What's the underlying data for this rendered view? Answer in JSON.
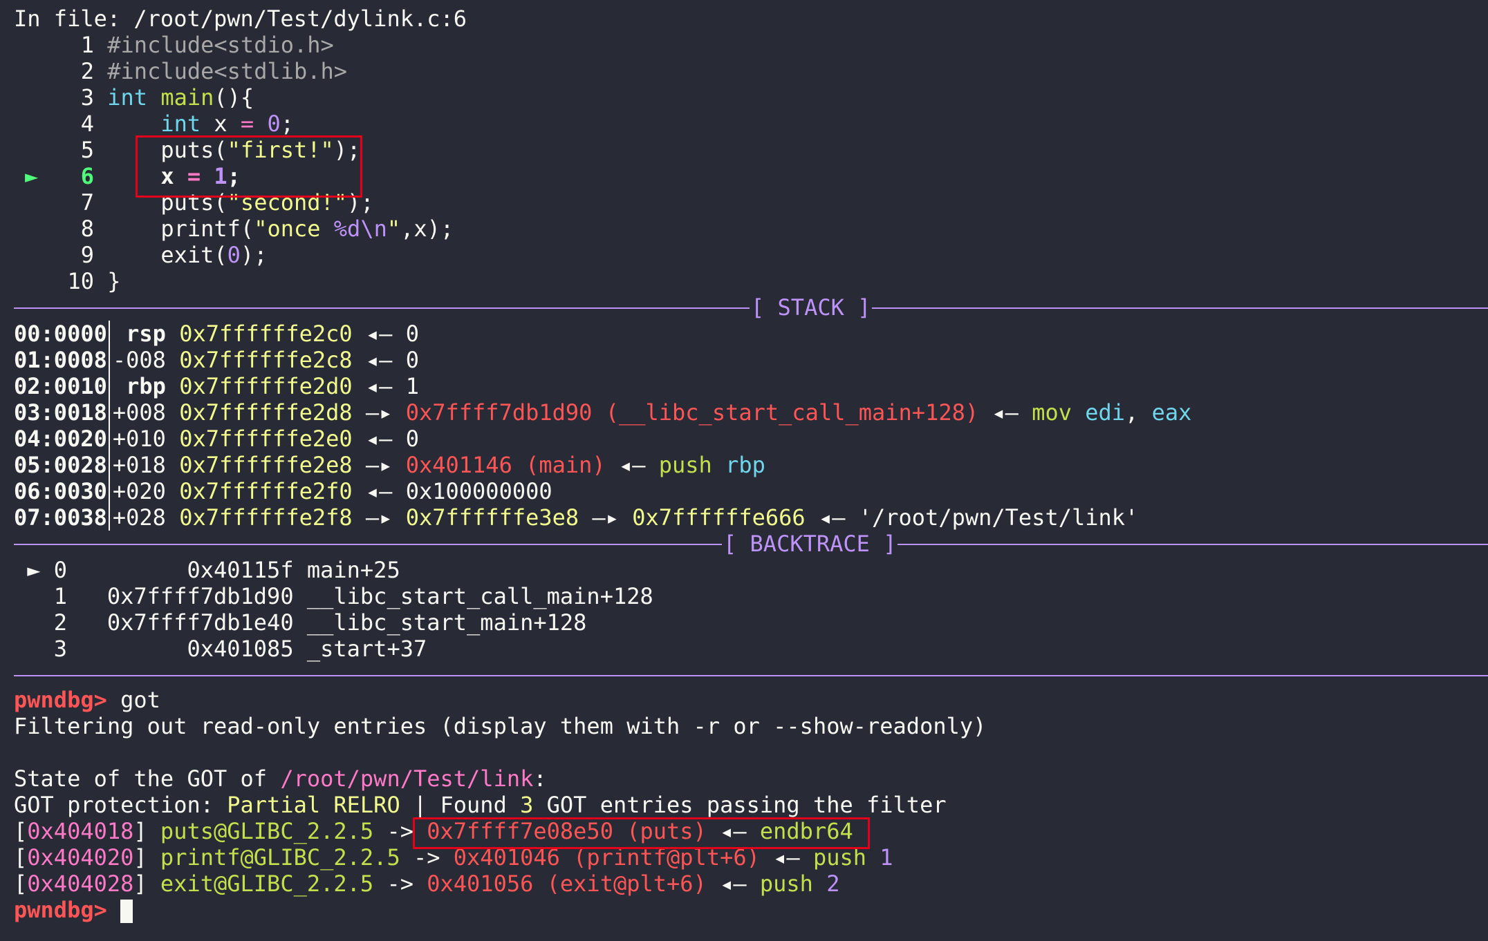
{
  "file_header": {
    "prefix": "In file: ",
    "path": "/root/pwn/Test/dylink.c:6"
  },
  "source": {
    "current_marker": "►",
    "lines": [
      {
        "no": "1",
        "tokens": [
          {
            "t": "#include<stdio.h>",
            "c": "gray"
          }
        ]
      },
      {
        "no": "2",
        "tokens": [
          {
            "t": "#include<stdlib.h>",
            "c": "gray"
          }
        ]
      },
      {
        "no": "3",
        "tokens": [
          {
            "t": "int",
            "c": "cyan"
          },
          {
            "t": " ",
            "c": "white"
          },
          {
            "t": "main",
            "c": "green"
          },
          {
            "t": "(){",
            "c": "white"
          }
        ]
      },
      {
        "no": "4",
        "tokens": [
          {
            "t": "    ",
            "c": "white"
          },
          {
            "t": "int",
            "c": "cyan"
          },
          {
            "t": " x ",
            "c": "white"
          },
          {
            "t": "=",
            "c": "pink"
          },
          {
            "t": " ",
            "c": "white"
          },
          {
            "t": "0",
            "c": "purple"
          },
          {
            "t": ";",
            "c": "white"
          }
        ]
      },
      {
        "no": "5",
        "tokens": [
          {
            "t": "    puts(",
            "c": "white"
          },
          {
            "t": "\"first!\"",
            "c": "strgreen"
          },
          {
            "t": ");",
            "c": "white"
          }
        ]
      },
      {
        "no": "6",
        "current": true,
        "tokens": [
          {
            "t": "    x ",
            "c": "white"
          },
          {
            "t": "=",
            "c": "pink"
          },
          {
            "t": " ",
            "c": "white"
          },
          {
            "t": "1",
            "c": "purple"
          },
          {
            "t": ";",
            "c": "white"
          }
        ]
      },
      {
        "no": "7",
        "tokens": [
          {
            "t": "    puts(",
            "c": "white"
          },
          {
            "t": "\"second!\"",
            "c": "strgreen"
          },
          {
            "t": ");",
            "c": "white"
          }
        ]
      },
      {
        "no": "8",
        "tokens": [
          {
            "t": "    printf(",
            "c": "white"
          },
          {
            "t": "\"once ",
            "c": "strgreen"
          },
          {
            "t": "%d",
            "c": "purple"
          },
          {
            "t": "\\n",
            "c": "purple"
          },
          {
            "t": "\"",
            "c": "strgreen"
          },
          {
            "t": ",x);",
            "c": "white"
          }
        ]
      },
      {
        "no": "9",
        "tokens": [
          {
            "t": "    exit(",
            "c": "white"
          },
          {
            "t": "0",
            "c": "purple"
          },
          {
            "t": ");",
            "c": "white"
          }
        ]
      },
      {
        "no": "10",
        "tokens": [
          {
            "t": "}",
            "c": "white"
          }
        ]
      }
    ]
  },
  "stack_section": {
    "label": "[ STACK ]",
    "rows": [
      {
        "idx": "00:0000",
        "off": " rsp",
        "off_bold": true,
        "addr": "0x7ffffffe2c0",
        "rest": [
          {
            "t": " ◂— ",
            "c": "white"
          },
          {
            "t": "0",
            "c": "white"
          }
        ]
      },
      {
        "idx": "01:0008",
        "off": "-008",
        "off_bold": false,
        "addr": "0x7ffffffe2c8",
        "rest": [
          {
            "t": " ◂— ",
            "c": "white"
          },
          {
            "t": "0",
            "c": "white"
          }
        ]
      },
      {
        "idx": "02:0010",
        "off": " rbp",
        "off_bold": true,
        "addr": "0x7ffffffe2d0",
        "rest": [
          {
            "t": " ◂— ",
            "c": "white"
          },
          {
            "t": "1",
            "c": "white"
          }
        ]
      },
      {
        "idx": "03:0018",
        "off": "+008",
        "off_bold": false,
        "addr": "0x7ffffffe2d8",
        "rest": [
          {
            "t": " —▸ ",
            "c": "white"
          },
          {
            "t": "0x7ffff7db1d90 (__libc_start_call_main+128)",
            "c": "red"
          },
          {
            "t": " ◂— ",
            "c": "white"
          },
          {
            "t": "mov",
            "c": "green"
          },
          {
            "t": " ",
            "c": "white"
          },
          {
            "t": "edi",
            "c": "cyan"
          },
          {
            "t": ", ",
            "c": "white"
          },
          {
            "t": "eax",
            "c": "cyan"
          }
        ]
      },
      {
        "idx": "04:0020",
        "off": "+010",
        "off_bold": false,
        "addr": "0x7ffffffe2e0",
        "rest": [
          {
            "t": " ◂— ",
            "c": "white"
          },
          {
            "t": "0",
            "c": "white"
          }
        ]
      },
      {
        "idx": "05:0028",
        "off": "+018",
        "off_bold": false,
        "addr": "0x7ffffffe2e8",
        "rest": [
          {
            "t": " —▸ ",
            "c": "white"
          },
          {
            "t": "0x401146 (main)",
            "c": "red"
          },
          {
            "t": " ◂— ",
            "c": "white"
          },
          {
            "t": "push",
            "c": "green"
          },
          {
            "t": " ",
            "c": "white"
          },
          {
            "t": "rbp",
            "c": "cyan"
          }
        ]
      },
      {
        "idx": "06:0030",
        "off": "+020",
        "off_bold": false,
        "addr": "0x7ffffffe2f0",
        "rest": [
          {
            "t": " ◂— ",
            "c": "white"
          },
          {
            "t": "0x100000000",
            "c": "white"
          }
        ]
      },
      {
        "idx": "07:0038",
        "off": "+028",
        "off_bold": false,
        "addr": "0x7ffffffe2f8",
        "rest": [
          {
            "t": " —▸ ",
            "c": "white"
          },
          {
            "t": "0x7ffffffe3e8",
            "c": "yellow"
          },
          {
            "t": " —▸ ",
            "c": "white"
          },
          {
            "t": "0x7ffffffe666",
            "c": "yellow"
          },
          {
            "t": " ◂— ",
            "c": "white"
          },
          {
            "t": "'/root/pwn/Test/link'",
            "c": "white"
          }
        ]
      }
    ]
  },
  "backtrace_section": {
    "label": "[ BACKTRACE ]",
    "rows": [
      {
        "text": " ► 0         0x40115f main+25"
      },
      {
        "text": "   1   0x7ffff7db1d90 __libc_start_call_main+128"
      },
      {
        "text": "   2   0x7ffff7db1e40 __libc_start_main+128"
      },
      {
        "text": "   3         0x401085 _start+37"
      }
    ]
  },
  "console": {
    "prompt": "pwndbg>",
    "command": " got",
    "filter_note": "Filtering out read-only entries (display them with -r or --show-readonly)",
    "state_prefix": "State of the GOT of ",
    "state_path": "/root/pwn/Test/link",
    "state_suffix": ":",
    "protection_prefix": "GOT protection: ",
    "protection_value": "Partial RELRO",
    "found_prefix": " | Found ",
    "found_count": "3",
    "found_suffix": " GOT entries passing the filter",
    "entries": [
      {
        "addr": "0x404018",
        "sym": "puts@GLIBC_2.2.5",
        "target": "0x7ffff7e08e50 (puts)",
        "instr": "endbr64",
        "operand": ""
      },
      {
        "addr": "0x404020",
        "sym": "printf@GLIBC_2.2.5",
        "target": "0x401046 (printf@plt+6)",
        "instr": "push",
        "operand": "1"
      },
      {
        "addr": "0x404028",
        "sym": "exit@GLIBC_2.2.5",
        "target": "0x401056 (exit@plt+6)",
        "instr": "push",
        "operand": "2"
      }
    ]
  },
  "colors": {
    "background": "#282a36",
    "section_rule": "#bd93f9",
    "highlight_box": "#e3001b"
  }
}
